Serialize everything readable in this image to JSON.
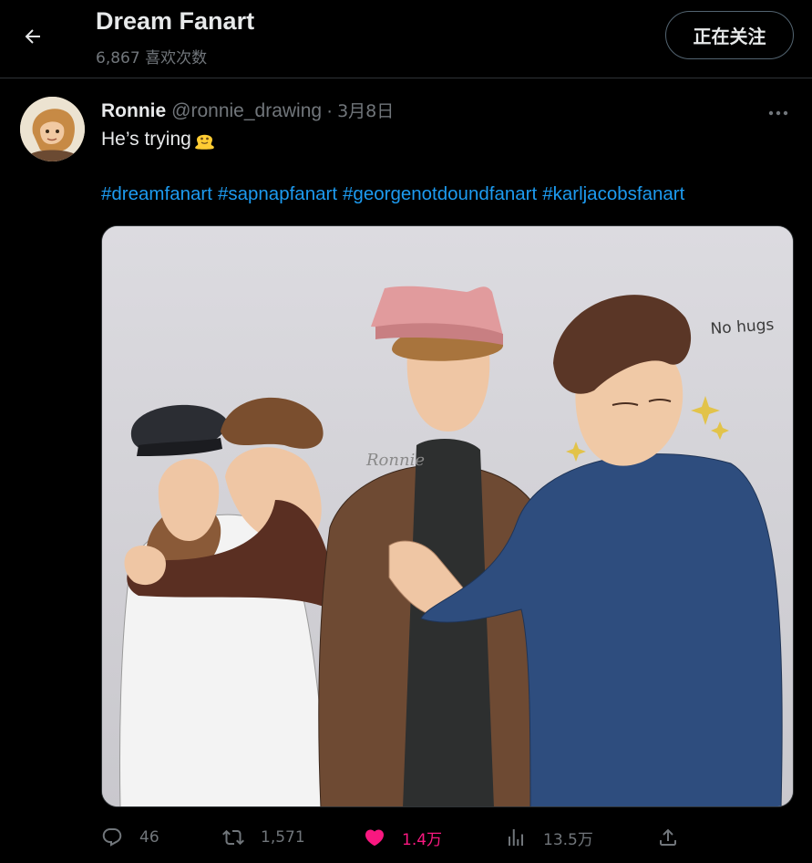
{
  "header": {
    "title": "Dream Fanart",
    "subtitle": "6,867 喜欢次数",
    "follow_label": "正在关注"
  },
  "post": {
    "author_name": "Ronnie",
    "author_handle": "@ronnie_drawing",
    "separator": "·",
    "date": "3月8日",
    "text": "He’s trying",
    "emoji": "melting-face",
    "hashtags": [
      "#dreamfanart",
      "#sapnapfanart",
      "#georgenotdoundfanart",
      "#karljacobsfanart"
    ],
    "image_annotation": "No hugs"
  },
  "actions": {
    "replies": "46",
    "reposts": "1,571",
    "likes": "1.4万",
    "views": "13.5万"
  },
  "colors": {
    "background": "#000000",
    "link": "#1d9bf0",
    "muted": "#71767b",
    "like": "#f91880"
  }
}
